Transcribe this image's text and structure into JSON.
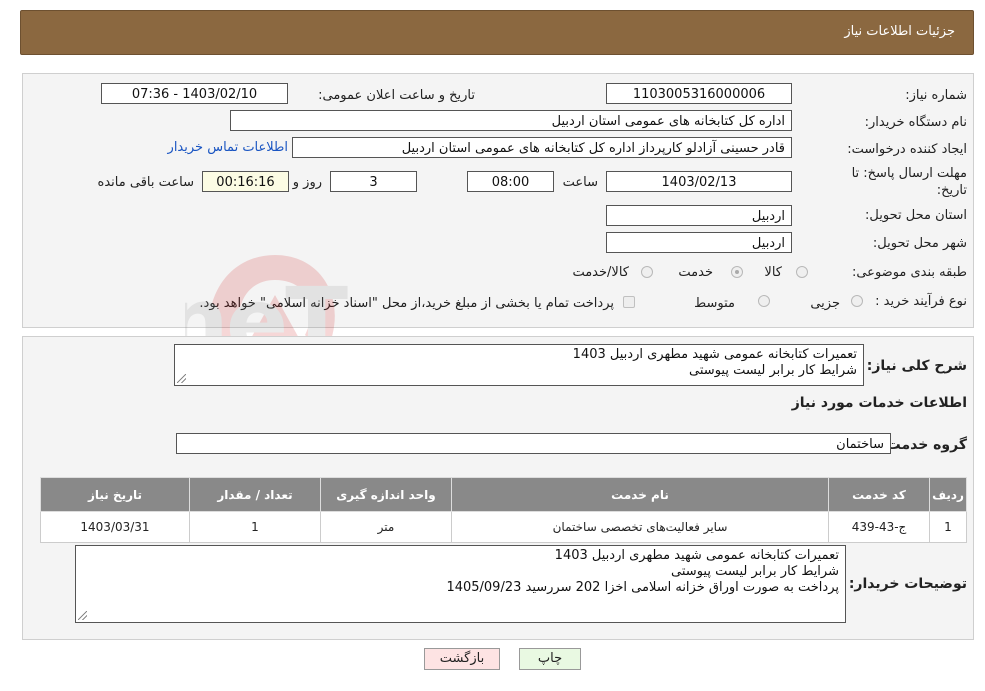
{
  "header": {
    "title": "جزئیات اطلاعات نیاز"
  },
  "form": {
    "need_number_label": "شماره نیاز:",
    "need_number": "1103005316000006",
    "announce_label": "تاریخ و ساعت اعلان عمومی:",
    "announce_value": "1403/02/10 - 07:36",
    "buyer_org_label": "نام دستگاه خریدار:",
    "buyer_org": "اداره کل کتابخانه های عمومی استان اردبیل",
    "creator_label": "ایجاد کننده درخواست:",
    "creator": "قادر حسینی آزادلو کارپرداز اداره کل کتابخانه های عمومی استان اردبیل",
    "contact_link": "اطلاعات تماس خریدار",
    "deadline_label_1": "مهلت ارسال پاسخ: تا",
    "deadline_label_2": "تاریخ:",
    "deadline_date": "1403/02/13",
    "time_label": "ساعت",
    "deadline_time": "08:00",
    "days_value": "3",
    "days_label": "روز و",
    "remaining_time": "00:16:16",
    "remaining_label": "ساعت باقی مانده",
    "province_label": "استان محل تحویل:",
    "province": "اردبیل",
    "city_label": "شهر محل تحویل:",
    "city": "اردبیل",
    "category_label": "طبقه بندی موضوعی:",
    "category_options": [
      "کالا",
      "خدمت",
      "کالا/خدمت"
    ],
    "purchase_type_label": "نوع فرآیند خرید :",
    "purchase_options": [
      "جزیی",
      "متوسط"
    ],
    "payment_note": "پرداخت تمام یا بخشی از مبلغ خرید،از محل \"اسناد خزانه اسلامی\" خواهد بود."
  },
  "summary": {
    "label": "شرح کلی نیاز:",
    "lines": [
      "تعمیرات کتابخانه عمومی شهید مطهری اردبیل 1403",
      "شرایط کار برابر لیست پیوستی"
    ]
  },
  "services": {
    "section_title": "اطلاعات خدمات مورد نیاز",
    "group_label": "گروه خدمت:",
    "group_value": "ساختمان",
    "table_headers": [
      "ردیف",
      "کد خدمت",
      "نام خدمت",
      "واحد اندازه گیری",
      "تعداد / مقدار",
      "تاریخ نیاز"
    ],
    "rows": [
      [
        "1",
        "ج-43-439",
        "سایر فعالیت‌های تخصصی ساختمان",
        "متر",
        "1",
        "1403/03/31"
      ]
    ]
  },
  "buyer_notes": {
    "label": "توضیحات خریدار:",
    "lines": [
      "تعمیرات کتابخانه عمومی شهید مطهری اردبیل 1403",
      "شرایط کار برابر لیست پیوستی",
      "پرداخت به صورت اوراق خزانه اسلامی اخزا 202 سررسید 1405/09/23"
    ]
  },
  "buttons": {
    "print": "چاپ",
    "back": "بازگشت"
  },
  "colors": {
    "header_bg": "#8b6840",
    "table_header_bg": "#898989",
    "print_btn": "#e9f9e2",
    "back_btn": "#fde3e3",
    "link": "#1a55c2"
  }
}
